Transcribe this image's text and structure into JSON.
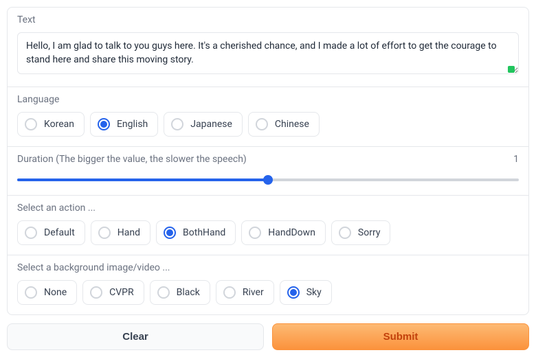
{
  "textSection": {
    "label": "Text",
    "value": "Hello, I am glad to talk to you guys here. It's a cherished chance, and I made a lot of effort to get the courage to stand here and share this moving story."
  },
  "language": {
    "label": "Language",
    "options": [
      "Korean",
      "English",
      "Japanese",
      "Chinese"
    ],
    "selected": "English"
  },
  "duration": {
    "label": "Duration (The bigger the value, the slower the speech)",
    "value": 1,
    "fillPercent": 50
  },
  "action": {
    "label": "Select an action ...",
    "options": [
      "Default",
      "Hand",
      "BothHand",
      "HandDown",
      "Sorry"
    ],
    "selected": "BothHand"
  },
  "background": {
    "label": "Select a background image/video ...",
    "options": [
      "None",
      "CVPR",
      "Black",
      "River",
      "Sky"
    ],
    "selected": "Sky"
  },
  "buttons": {
    "clear": "Clear",
    "submit": "Submit"
  }
}
